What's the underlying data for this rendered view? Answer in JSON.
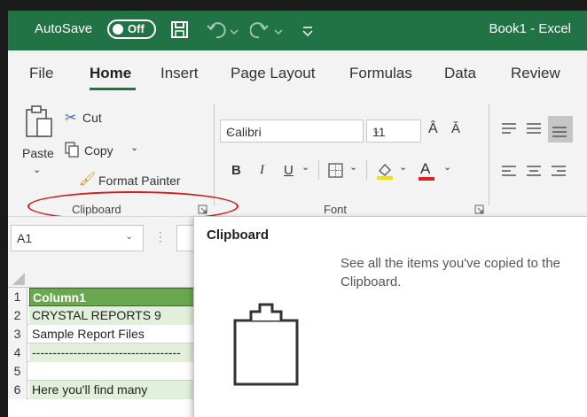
{
  "titlebar": {
    "autosave_label": "AutoSave",
    "toggle_state": "Off",
    "book_title": "Book1  -  Excel",
    "accent_color": "#217346"
  },
  "tabs": [
    "File",
    "Home",
    "Insert",
    "Page Layout",
    "Formulas",
    "Data",
    "Review"
  ],
  "active_tab": "Home",
  "clipboard_group": {
    "paste_label": "Paste",
    "cut_label": "Cut",
    "copy_label": "Copy",
    "format_painter_label": "Format Painter",
    "group_label": "Clipboard"
  },
  "font_group": {
    "font_name": "Calibri",
    "font_size": "11",
    "bold": "B",
    "italic": "I",
    "underline": "U",
    "group_label": "Font"
  },
  "name_box": {
    "value": "A1"
  },
  "grid": {
    "rows": [
      {
        "num": "1",
        "value": "Column1"
      },
      {
        "num": "2",
        "value": "CRYSTAL REPORTS 9"
      },
      {
        "num": "3",
        "value": "Sample Report Files"
      },
      {
        "num": "4",
        "value": "------------------------------------"
      },
      {
        "num": "5",
        "value": ""
      },
      {
        "num": "6",
        "value": "Here you'll find many"
      }
    ]
  },
  "tooltip": {
    "title": "Clipboard",
    "description": "See all the items you've copied to the Clipboard."
  },
  "highlight_color": "#d11c1c"
}
